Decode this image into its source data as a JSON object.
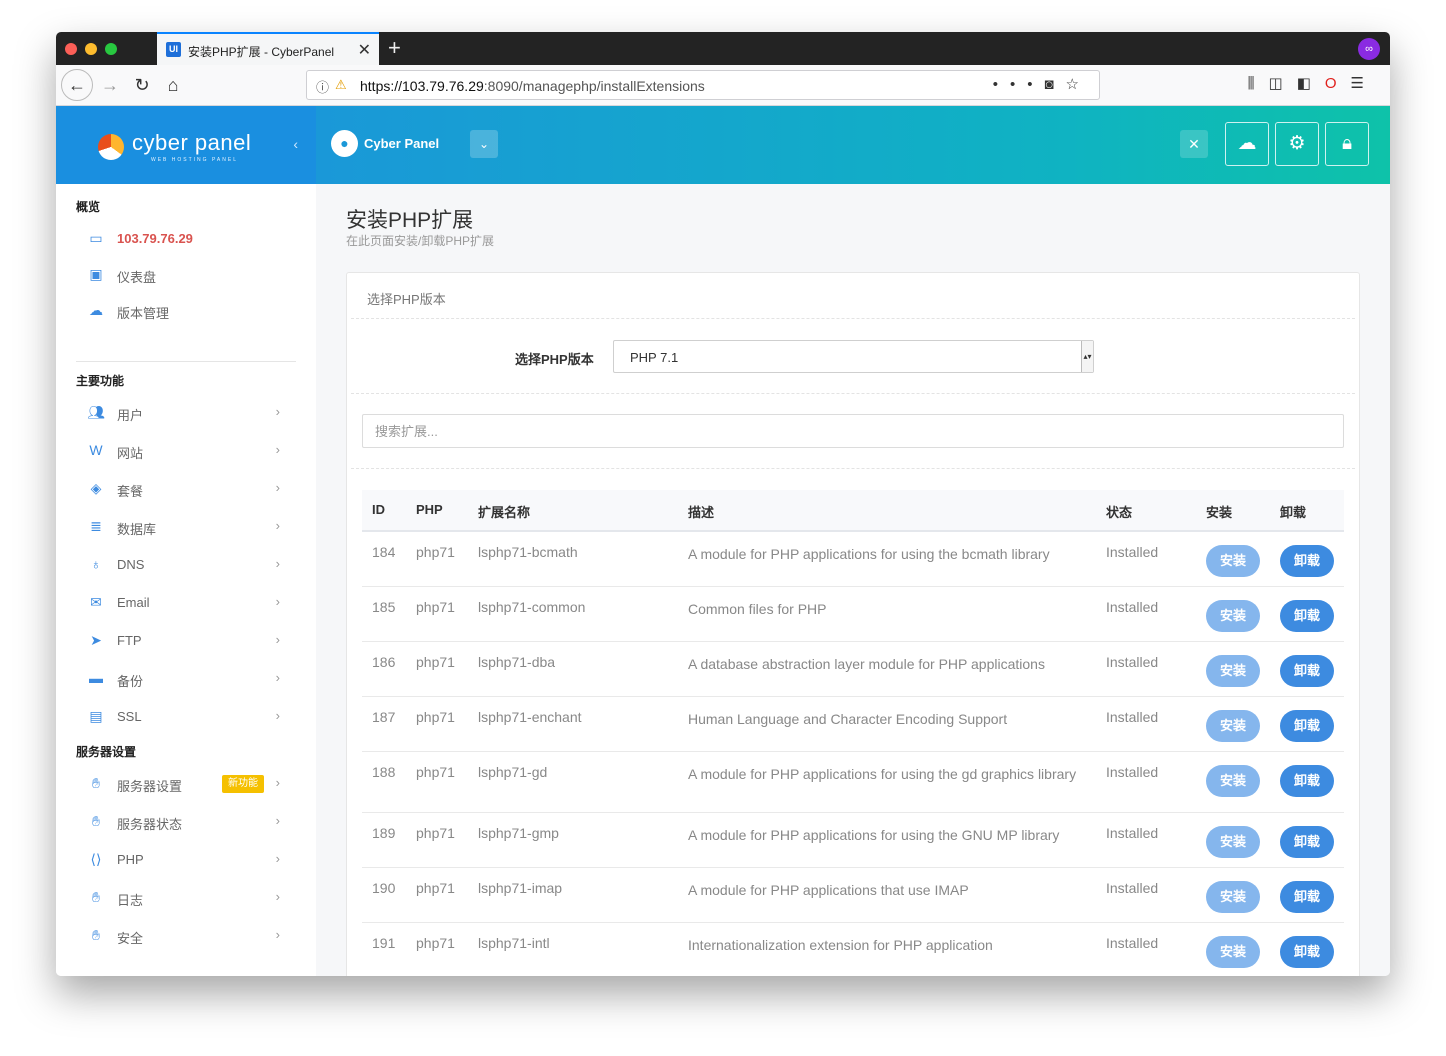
{
  "browser": {
    "tab_title": "安装PHP扩展 - CyberPanel",
    "tab_favicon": "UI",
    "url_host": "https://103.79.76.29",
    "url_path": ":8090/managephp/installExtensions"
  },
  "brand": {
    "name": "cyber panel",
    "tagline": "WEB HOSTING PANEL"
  },
  "header": {
    "user_name": "Cyber Panel"
  },
  "sidebar": {
    "sections": {
      "overview": "概览",
      "main": "主要功能",
      "server": "服务器设置"
    },
    "overview_items": [
      {
        "label": "103.79.76.29",
        "icon": "laptop-icon"
      },
      {
        "label": "仪表盘",
        "icon": "dashboard-icon"
      },
      {
        "label": "版本管理",
        "icon": "cloud-upload-icon"
      }
    ],
    "main_items": [
      {
        "label": "用户",
        "icon": "users-icon"
      },
      {
        "label": "网站",
        "icon": "website-icon"
      },
      {
        "label": "套餐",
        "icon": "packages-icon"
      },
      {
        "label": "数据库",
        "icon": "database-icon"
      },
      {
        "label": "DNS",
        "icon": "bulb-icon"
      },
      {
        "label": "Email",
        "icon": "envelope-icon"
      },
      {
        "label": "FTP",
        "icon": "paper-plane-icon"
      },
      {
        "label": "备份",
        "icon": "folder-icon"
      },
      {
        "label": "SSL",
        "icon": "briefcase-icon"
      }
    ],
    "server_items": [
      {
        "label": "服务器设置",
        "icon": "hand-icon",
        "badge": "新功能"
      },
      {
        "label": "服务器状态",
        "icon": "hand-icon"
      },
      {
        "label": "PHP",
        "icon": "code-file-icon"
      },
      {
        "label": "日志",
        "icon": "hand-icon"
      },
      {
        "label": "安全",
        "icon": "hand-icon"
      }
    ]
  },
  "page": {
    "title": "安装PHP扩展",
    "subtitle": "在此页面安装/卸载PHP扩展",
    "panel_title": "选择PHP版本",
    "version_label": "选择PHP版本",
    "version_value": "PHP 7.1",
    "search_placeholder": "搜索扩展..."
  },
  "table": {
    "headers": {
      "id": "ID",
      "php": "PHP",
      "name": "扩展名称",
      "desc": "描述",
      "status": "状态",
      "install": "安装",
      "uninstall": "卸载"
    },
    "install_label": "安装",
    "uninstall_label": "卸载",
    "rows": [
      {
        "id": "184",
        "php": "php71",
        "name": "lsphp71-bcmath",
        "desc": "A module for PHP applications for using the bcmath library",
        "status": "Installed"
      },
      {
        "id": "185",
        "php": "php71",
        "name": "lsphp71-common",
        "desc": "Common files for PHP",
        "status": "Installed"
      },
      {
        "id": "186",
        "php": "php71",
        "name": "lsphp71-dba",
        "desc": "A database abstraction layer module for PHP applications",
        "status": "Installed"
      },
      {
        "id": "187",
        "php": "php71",
        "name": "lsphp71-enchant",
        "desc": "Human Language and Character Encoding Support",
        "status": "Installed"
      },
      {
        "id": "188",
        "php": "php71",
        "name": "lsphp71-gd",
        "desc": "A module for PHP applications for using the gd graphics library",
        "status": "Installed"
      },
      {
        "id": "189",
        "php": "php71",
        "name": "lsphp71-gmp",
        "desc": "A module for PHP applications for using the GNU MP library",
        "status": "Installed"
      },
      {
        "id": "190",
        "php": "php71",
        "name": "lsphp71-imap",
        "desc": "A module for PHP applications that use IMAP",
        "status": "Installed"
      },
      {
        "id": "191",
        "php": "php71",
        "name": "lsphp71-intl",
        "desc": "Internationalization extension for PHP application",
        "status": "Installed"
      }
    ]
  },
  "colors": {
    "accent": "#3d8be0",
    "ip_highlight": "#d9534f",
    "badge": "#f5c000"
  }
}
